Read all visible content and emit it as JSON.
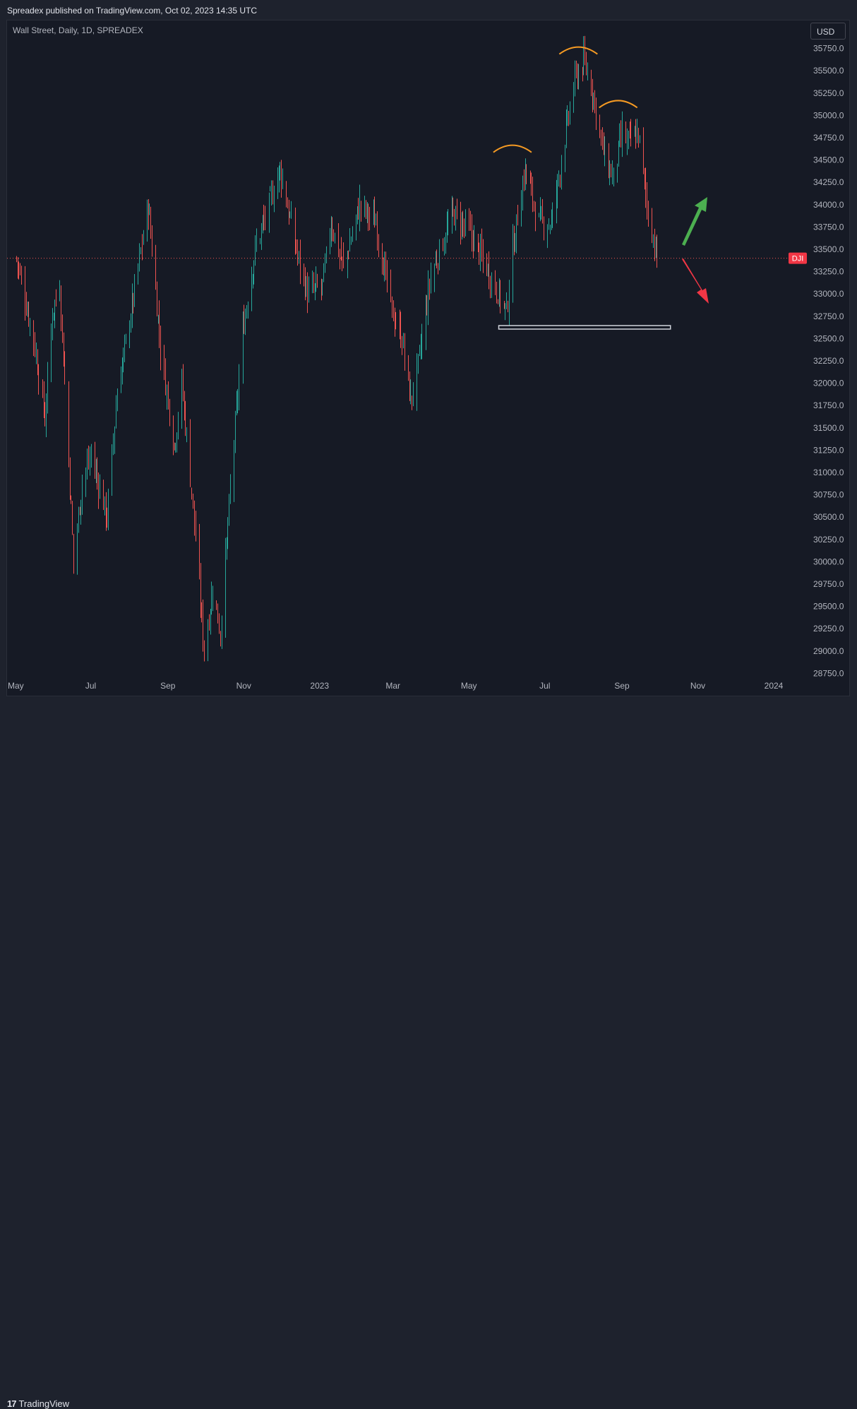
{
  "header": {
    "published": "Spreadex published on TradingView.com, Oct 02, 2023 14:35 UTC"
  },
  "symbol_info": "Wall Street, Daily, 1D, SPREADEX",
  "currency_button": "USD",
  "price_tag": "DJI",
  "footer": {
    "logo_mark": "17",
    "logo_text": "TradingView"
  },
  "colors": {
    "up": "#26a69a",
    "down": "#ef5350",
    "background": "#161a25",
    "price_line": "#ef5350",
    "arc": "#f59a23",
    "arrow_up": "#4caf50",
    "arrow_down": "#f23645"
  },
  "chart_data": {
    "type": "candlestick",
    "title": "Wall Street, Daily, 1D, SPREADEX",
    "y_ticks": [
      35750,
      35500,
      35250,
      35000,
      34750,
      34500,
      34250,
      34000,
      33750,
      33500,
      33250,
      33000,
      32750,
      32500,
      32250,
      32000,
      31750,
      31500,
      31250,
      31000,
      30750,
      30500,
      30250,
      30000,
      29750,
      29500,
      29250,
      29000,
      28750
    ],
    "y_tick_labels": [
      "35750.0",
      "35500.0",
      "35250.0",
      "35000.0",
      "34750.0",
      "34500.0",
      "34250.0",
      "34000.0",
      "33750.0",
      "33500.0",
      "33250.0",
      "33000.0",
      "32750.0",
      "32500.0",
      "32250.0",
      "32000.0",
      "31750.0",
      "31500.0",
      "31250.0",
      "31000.0",
      "30750.0",
      "30500.0",
      "30250.0",
      "30000.0",
      "29750.0",
      "29500.0",
      "29250.0",
      "29000.0",
      "28750.0"
    ],
    "ylim": [
      28600,
      36000
    ],
    "x_labels": [
      {
        "label": "May",
        "date": "2022-05-01"
      },
      {
        "label": "Jul",
        "date": "2022-07-01"
      },
      {
        "label": "Sep",
        "date": "2022-09-01"
      },
      {
        "label": "Nov",
        "date": "2022-11-01"
      },
      {
        "label": "2023",
        "date": "2023-01-01"
      },
      {
        "label": "Mar",
        "date": "2023-03-01"
      },
      {
        "label": "May",
        "date": "2023-05-01"
      },
      {
        "label": "Jul",
        "date": "2023-07-01"
      },
      {
        "label": "Sep",
        "date": "2023-09-01"
      },
      {
        "label": "Nov",
        "date": "2023-11-01"
      },
      {
        "label": "2024",
        "date": "2024-01-01"
      }
    ],
    "current_price": 33400,
    "close_path": [
      {
        "date": "2022-05-02",
        "close": 33400
      },
      {
        "date": "2022-05-16",
        "close": 32500
      },
      {
        "date": "2022-05-25",
        "close": 31600
      },
      {
        "date": "2022-05-31",
        "close": 32800
      },
      {
        "date": "2022-06-06",
        "close": 33100
      },
      {
        "date": "2022-06-10",
        "close": 32000
      },
      {
        "date": "2022-06-17",
        "close": 30000
      },
      {
        "date": "2022-06-24",
        "close": 30900
      },
      {
        "date": "2022-07-01",
        "close": 31200
      },
      {
        "date": "2022-07-14",
        "close": 30500
      },
      {
        "date": "2022-07-22",
        "close": 31900
      },
      {
        "date": "2022-08-01",
        "close": 32700
      },
      {
        "date": "2022-08-16",
        "close": 34000
      },
      {
        "date": "2022-08-26",
        "close": 32400
      },
      {
        "date": "2022-09-06",
        "close": 31300
      },
      {
        "date": "2022-09-12",
        "close": 32000
      },
      {
        "date": "2022-09-20",
        "close": 30800
      },
      {
        "date": "2022-09-30",
        "close": 29000
      },
      {
        "date": "2022-10-07",
        "close": 29700
      },
      {
        "date": "2022-10-13",
        "close": 29200
      },
      {
        "date": "2022-10-21",
        "close": 30800
      },
      {
        "date": "2022-10-31",
        "close": 32600
      },
      {
        "date": "2022-11-10",
        "close": 33500
      },
      {
        "date": "2022-11-30",
        "close": 34400
      },
      {
        "date": "2022-12-13",
        "close": 33500
      },
      {
        "date": "2022-12-22",
        "close": 33000
      },
      {
        "date": "2023-01-03",
        "close": 33100
      },
      {
        "date": "2023-01-10",
        "close": 33800
      },
      {
        "date": "2023-01-20",
        "close": 33300
      },
      {
        "date": "2023-02-02",
        "close": 34000
      },
      {
        "date": "2023-02-15",
        "close": 33800
      },
      {
        "date": "2023-02-28",
        "close": 32800
      },
      {
        "date": "2023-03-08",
        "close": 32500
      },
      {
        "date": "2023-03-15",
        "close": 31800
      },
      {
        "date": "2023-03-21",
        "close": 32200
      },
      {
        "date": "2023-03-31",
        "close": 33200
      },
      {
        "date": "2023-04-18",
        "close": 33900
      },
      {
        "date": "2023-05-01",
        "close": 33700
      },
      {
        "date": "2023-05-15",
        "close": 33300
      },
      {
        "date": "2023-05-31",
        "close": 32800
      },
      {
        "date": "2023-06-05",
        "close": 33500
      },
      {
        "date": "2023-06-15",
        "close": 34400
      },
      {
        "date": "2023-06-26",
        "close": 33800
      },
      {
        "date": "2023-07-06",
        "close": 33800
      },
      {
        "date": "2023-07-14",
        "close": 34500
      },
      {
        "date": "2023-07-25",
        "close": 35400
      },
      {
        "date": "2023-08-01",
        "close": 35600
      },
      {
        "date": "2023-08-08",
        "close": 35300
      },
      {
        "date": "2023-08-18",
        "close": 34500
      },
      {
        "date": "2023-08-25",
        "close": 34300
      },
      {
        "date": "2023-09-01",
        "close": 34800
      },
      {
        "date": "2023-09-05",
        "close": 34700
      },
      {
        "date": "2023-09-14",
        "close": 34800
      },
      {
        "date": "2023-09-21",
        "close": 34000
      },
      {
        "date": "2023-09-29",
        "close": 33400
      }
    ],
    "annotations": [
      {
        "type": "arc",
        "center_date": "2023-06-05",
        "center_price": 34650,
        "label": ""
      },
      {
        "type": "arc",
        "center_date": "2023-07-28",
        "center_price": 35750,
        "label": ""
      },
      {
        "type": "arc",
        "center_date": "2023-08-29",
        "center_price": 35150,
        "label": ""
      },
      {
        "type": "rectangle",
        "from_date": "2023-05-25",
        "to_date": "2023-10-10",
        "price_top": 32630,
        "price_bottom": 32600
      },
      {
        "type": "arrow",
        "direction": "up",
        "color": "green"
      },
      {
        "type": "arrow",
        "direction": "down",
        "color": "red"
      }
    ]
  }
}
